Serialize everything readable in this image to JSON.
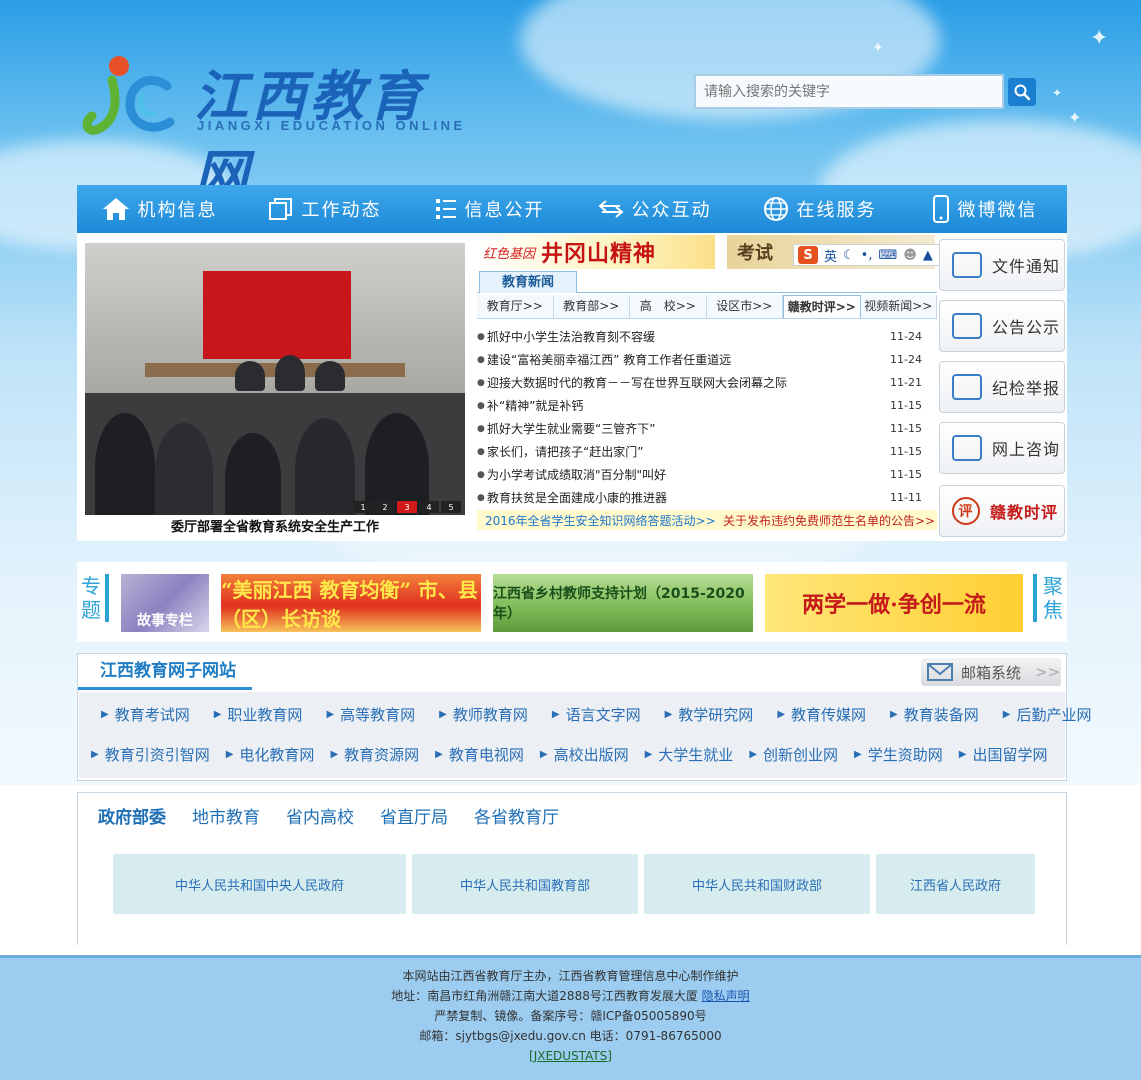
{
  "header": {
    "logo_title": "江西教育网",
    "logo_subtitle": "JIANGXI EDUCATION ONLINE",
    "search_placeholder": "请输入搜索的关键字"
  },
  "nav": [
    {
      "label": "机构信息",
      "icon": "home-icon"
    },
    {
      "label": "工作动态",
      "icon": "document-stack-icon"
    },
    {
      "label": "信息公开",
      "icon": "list-icon"
    },
    {
      "label": "公众互动",
      "icon": "exchange-arrows-icon"
    },
    {
      "label": "在线服务",
      "icon": "globe-icon"
    },
    {
      "label": "微博微信",
      "icon": "phone-icon"
    }
  ],
  "slideshow": {
    "caption": "委厅部署全省教育系统安全生产工作",
    "pages": [
      "1",
      "2",
      "3",
      "4",
      "5"
    ],
    "active_page": "3"
  },
  "banners": {
    "jinggang_small": "红色基因",
    "jinggang_big": "井冈山精神",
    "exam": "考试"
  },
  "ime_bar": {
    "logo": "S",
    "lang": "英"
  },
  "news": {
    "tab": "教育新闻",
    "subtabs": [
      "教育厅>>",
      "教育部>>",
      "高　校>>",
      "设区市>>",
      "赣教时评>>",
      "视频新闻>>"
    ],
    "active_subtab": "赣教时评>>",
    "items": [
      {
        "title": "抓好中小学生法治教育刻不容缓",
        "date": "11-24"
      },
      {
        "title": "建设“富裕美丽幸福江西” 教育工作者任重道远",
        "date": "11-24"
      },
      {
        "title": "迎接大数据时代的教育－－写在世界互联网大会闭幕之际",
        "date": "11-21"
      },
      {
        "title": "补“精神”就是补钙",
        "date": "11-15"
      },
      {
        "title": "抓好大学生就业需要“三管齐下”",
        "date": "11-15"
      },
      {
        "title": "家长们，请把孩子“赶出家门”",
        "date": "11-15"
      },
      {
        "title": "为小学考试成绩取消\"百分制\"叫好",
        "date": "11-15"
      },
      {
        "title": "教育扶贫是全面建成小康的推进器",
        "date": "11-11"
      }
    ],
    "notice_left": "2016年全省学生安全知识网络答题活动>>",
    "notice_right": "关于发布违约免费师范生名单的公告>>"
  },
  "side_buttons": [
    {
      "label": "文件通知",
      "icon": "document-icon"
    },
    {
      "label": "公告公示",
      "icon": "card-icon"
    },
    {
      "label": "纪检举报",
      "icon": "envelope-icon"
    },
    {
      "label": "网上咨询",
      "icon": "monitor-icon"
    },
    {
      "label": "赣教时评",
      "icon": "comment-icon",
      "icon_char": "评"
    }
  ],
  "topics": {
    "left_label": "专题",
    "right_label": "聚焦",
    "banners": [
      "故事专栏",
      "“美丽江西 教育均衡” 市、县（区）长访谈",
      "江西省乡村教师支持计划（2015-2020年）",
      "两学一做·争创一流"
    ]
  },
  "subsites": {
    "title": "江西教育网子网站",
    "mail_label": "邮箱系统",
    "row1": [
      "教育考试网",
      "职业教育网",
      "高等教育网",
      "教师教育网",
      "语言文字网",
      "教学研究网",
      "教育传媒网",
      "教育装备网",
      "后勤产业网"
    ],
    "row2": [
      "教育引资引智网",
      "电化教育网",
      "教育资源网",
      "教育电视网",
      "高校出版网",
      "大学生就业",
      "创新创业网",
      "学生资助网",
      "出国留学网"
    ]
  },
  "gov": {
    "tabs": [
      "政府部委",
      "地市教育",
      "省内高校",
      "省直厅局",
      "各省教育厅"
    ],
    "active_tab": "政府部委",
    "links": [
      "中华人民共和国中央人民政府",
      "中华人民共和国教育部",
      "中华人民共和国财政部",
      "江西省人民政府"
    ]
  },
  "footer": {
    "line1": "本网站由江西省教育厅主办，江西省教育管理信息中心制作维护",
    "line2_prefix": "地址：南昌市红角洲赣江南大道2888号江西教育发展大厦",
    "privacy": "隐私声明",
    "line3": "严禁复制、镜像。备案序号：赣ICP备05005890号",
    "line4": "邮箱：sjytbgs@jxedu.gov.cn 电话：0791-86765000",
    "stats": "[JXEDUSTATS]"
  },
  "colors": {
    "nav_blue": "#1c88d6",
    "accent_blue": "#2da3d8",
    "news_red": "#c32222",
    "footer_bg": "#9ccdf0"
  }
}
